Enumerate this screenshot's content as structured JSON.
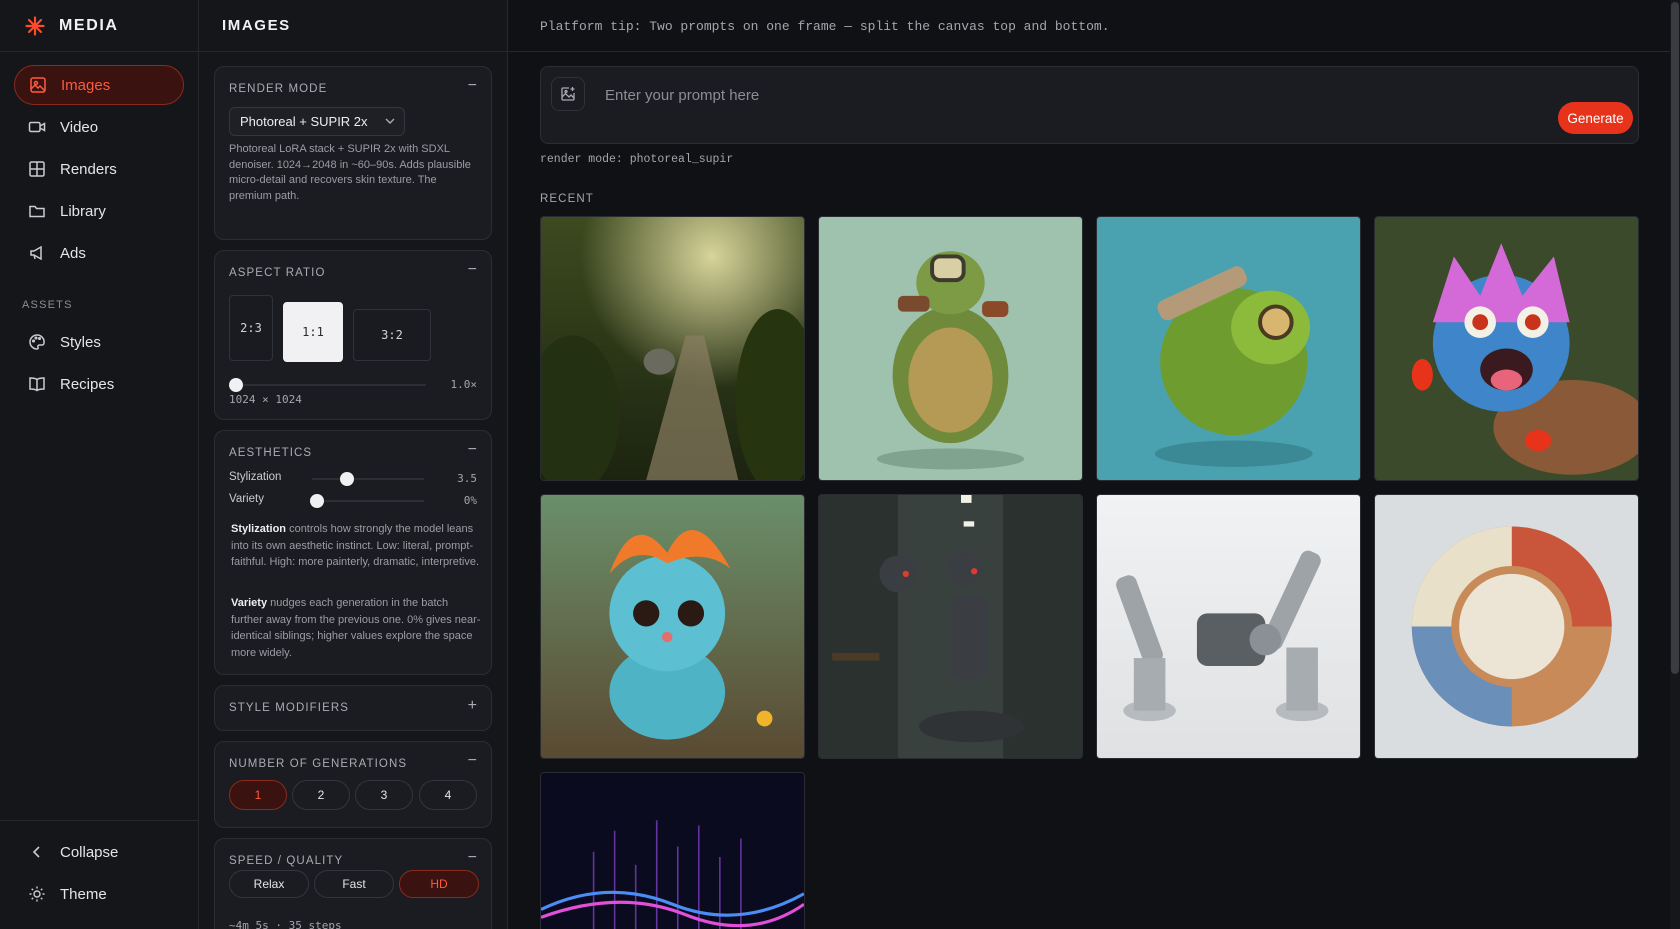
{
  "brand": {
    "name": "MEDIA"
  },
  "nav": {
    "items": [
      {
        "label": "Images"
      },
      {
        "label": "Video"
      },
      {
        "label": "Renders"
      },
      {
        "label": "Library"
      },
      {
        "label": "Ads"
      }
    ],
    "assets_heading": "ASSETS",
    "assets": [
      {
        "label": "Styles"
      },
      {
        "label": "Recipes"
      }
    ],
    "collapse_label": "Collapse",
    "theme_label": "Theme"
  },
  "panel": {
    "title": "IMAGES",
    "render_mode": {
      "title": "RENDER MODE",
      "toggle": "−",
      "selected": "Photoreal + SUPIR 2x",
      "description": "Photoreal LoRA stack + SUPIR 2x with SDXL denoiser. 1024→2048 in ~60–90s. Adds plausible micro-detail and recovers skin texture. The premium path."
    },
    "aspect_ratio": {
      "title": "ASPECT RATIO",
      "toggle": "−",
      "options": [
        "2:3",
        "1:1",
        "3:2"
      ],
      "selected": "1:1",
      "scale_label": "1.0×",
      "scale_value": 1.0,
      "dimensions": "1024 × 1024"
    },
    "aesthetics": {
      "title": "AESTHETICS",
      "toggle": "−",
      "stylization_label": "Stylization",
      "stylization_value": "3.5",
      "variety_label": "Variety",
      "variety_value": "0%",
      "stylization_term": "Stylization",
      "stylization_help": " controls how strongly the model leans into its own aesthetic instinct. Low: literal, prompt-faithful. High: more painterly, dramatic, interpretive.",
      "variety_term": "Variety",
      "variety_help": " nudges each generation in the batch further away from the previous one. 0% gives near-identical siblings; higher values explore the space more widely."
    },
    "style_modifiers": {
      "title": "STYLE MODIFIERS",
      "toggle": "+"
    },
    "generations": {
      "title": "NUMBER OF GENERATIONS",
      "toggle": "−",
      "options": [
        "1",
        "2",
        "3",
        "4"
      ],
      "selected": "1"
    },
    "speed": {
      "title": "SPEED / QUALITY",
      "toggle": "−",
      "options": [
        "Relax",
        "Fast",
        "HD"
      ],
      "selected": "HD",
      "estimate": "~4m 5s · 35 steps"
    }
  },
  "main": {
    "tip": "Platform tip: Two prompts on one frame — split the canvas top and bottom.",
    "prompt_placeholder": "Enter your prompt here",
    "generate_label": "Generate",
    "render_mode_note": "render mode: photoreal_supir",
    "recent_heading": "RECENT",
    "recent_images": [
      {
        "name": "forest-elephant-image"
      },
      {
        "name": "turtle-character-image"
      },
      {
        "name": "green-turtle-creature-image"
      },
      {
        "name": "feathered-monster-image"
      },
      {
        "name": "blue-furry-creature-image"
      },
      {
        "name": "robots-corridor-image"
      },
      {
        "name": "robot-arms-motor-image"
      },
      {
        "name": "coral-ring-image"
      },
      {
        "name": "sound-wave-image"
      }
    ]
  },
  "colors": {
    "accent": "#e8331b",
    "accent_text": "#ff5a3d",
    "background": "#101114"
  }
}
